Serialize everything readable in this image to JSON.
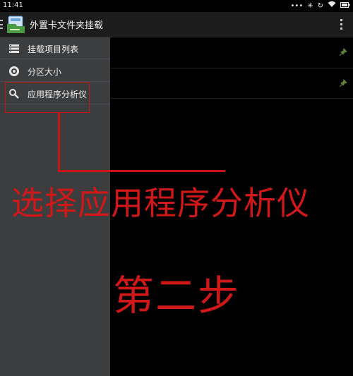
{
  "status_bar": {
    "time": "11:41",
    "icons": [
      "alarm-icon",
      "bluetooth-icon",
      "rotation-icon",
      "wifi-icon",
      "battery-icon"
    ]
  },
  "action_bar": {
    "title": "外置卡文件夹挂载",
    "menu_icon": "overflow-menu-icon"
  },
  "drawer": {
    "items": [
      {
        "label": "挂载项目列表",
        "icon": "list-icon"
      },
      {
        "label": "分区大小",
        "icon": "disk-icon"
      },
      {
        "label": "应用程序分析仪",
        "icon": "search-icon"
      }
    ]
  },
  "annotations": {
    "instruction": "选择应用程序分析仪",
    "step": "第二步",
    "color": "#d01818"
  },
  "colors": {
    "drawer_bg": "#3c3d3f",
    "actionbar_bg": "#1c1c1c",
    "background": "#000000"
  }
}
